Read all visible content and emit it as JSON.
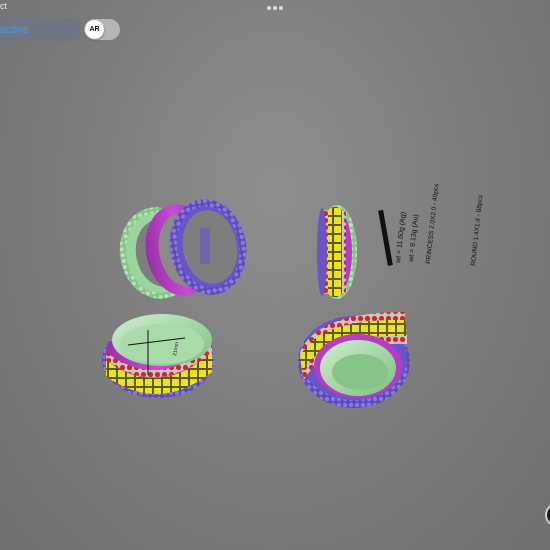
{
  "app": {
    "title_fragment": "ct"
  },
  "toolbar": {
    "more_icon": "more-dots-icon",
    "mode_label": "active",
    "ar_label": "AR",
    "ar_enabled": false
  },
  "viewport": {
    "background": "#7e7e7e",
    "colors": {
      "band_green": "#9fd6a1",
      "band_magenta": "#b63dc2",
      "band_purple": "#6b54c6",
      "stone_yellow": "#e7e11c",
      "stone_red": "#d92323"
    },
    "spec_lines": [
      "wt = 11.60g (Ag)",
      "wt = 9.13g (Au)",
      "PRINCESS 2.0X2.0 - 40pcs",
      "ROUND 1.4X1.4 - 88pcs"
    ],
    "dim_label": "21mm"
  }
}
